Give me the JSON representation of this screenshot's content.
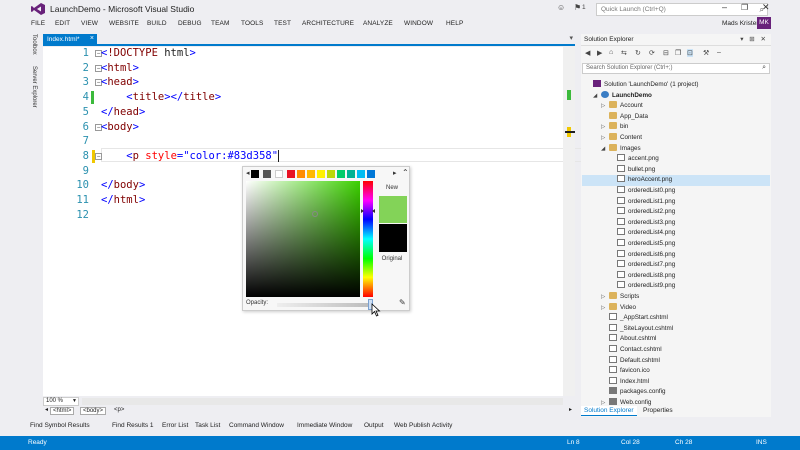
{
  "window": {
    "title": "LaunchDemo - Microsoft Visual Studio",
    "quick_launch_placeholder": "Quick Launch (Ctrl+Q)",
    "notification_count": "1"
  },
  "menu": [
    "FILE",
    "EDIT",
    "VIEW",
    "WEBSITE",
    "BUILD",
    "DEBUG",
    "TEAM",
    "TOOLS",
    "TEST",
    "ARCHITECTURE",
    "ANALYZE",
    "WINDOW",
    "HELP"
  ],
  "user": {
    "name": "Mads Kristensen",
    "initials": "MK"
  },
  "left_rail": [
    "Toolbox",
    "Server Explorer"
  ],
  "document_tab": {
    "label": "Index.html*"
  },
  "editor": {
    "lines": [
      {
        "n": "1",
        "text": "<!DOCTYPE html>"
      },
      {
        "n": "2",
        "text": "<html>"
      },
      {
        "n": "3",
        "text": "<head>"
      },
      {
        "n": "4",
        "text": "    <title></title>"
      },
      {
        "n": "5",
        "text": "</head>"
      },
      {
        "n": "6",
        "text": "<body>"
      },
      {
        "n": "7",
        "text": ""
      },
      {
        "n": "8",
        "text": "    <p style=\"color:#83d358\""
      },
      {
        "n": "9",
        "text": ""
      },
      {
        "n": "10",
        "text": "</body>"
      },
      {
        "n": "11",
        "text": "</html>"
      },
      {
        "n": "12",
        "text": ""
      }
    ],
    "zoom": "100 %",
    "breadcrumbs": [
      "<html>",
      "<body>",
      "<p>"
    ]
  },
  "color_picker": {
    "new_label": "New",
    "original_label": "Original",
    "opacity_label": "Opacity:",
    "new_color": "#83d358",
    "original_color": "#000000",
    "opacity": 1.0,
    "swatches": [
      "#000000",
      "#555555",
      "#ffffff",
      "#e81123",
      "#ff8c00",
      "#ffb900",
      "#fff100",
      "#bad80a",
      "#00cc6a",
      "#00b294",
      "#00bcf2",
      "#0078d7"
    ]
  },
  "solution_explorer": {
    "title": "Solution Explorer",
    "search_placeholder": "Search Solution Explorer (Ctrl+;)",
    "tree": [
      {
        "label": "Solution 'LaunchDemo' (1 project)",
        "icon": "solution-icon",
        "depth": 0,
        "arrow": ""
      },
      {
        "label": "LaunchDemo",
        "icon": "website-globe-icon",
        "depth": 1,
        "arrow": "◢",
        "bold": true
      },
      {
        "label": "Account",
        "icon": "folder-icon",
        "depth": 2,
        "arrow": "▷"
      },
      {
        "label": "App_Data",
        "icon": "folder-icon",
        "depth": 2,
        "arrow": ""
      },
      {
        "label": "bin",
        "icon": "folder-icon",
        "depth": 2,
        "arrow": "▷"
      },
      {
        "label": "Content",
        "icon": "folder-icon",
        "depth": 2,
        "arrow": "▷"
      },
      {
        "label": "Images",
        "icon": "folder-icon",
        "depth": 2,
        "arrow": "◢"
      },
      {
        "label": "accent.png",
        "icon": "image-file-icon",
        "depth": 3,
        "arrow": ""
      },
      {
        "label": "bullet.png",
        "icon": "image-file-icon",
        "depth": 3,
        "arrow": ""
      },
      {
        "label": "heroAccent.png",
        "icon": "image-file-icon",
        "depth": 3,
        "arrow": "",
        "selected": true
      },
      {
        "label": "orderedList0.png",
        "icon": "image-file-icon",
        "depth": 3,
        "arrow": ""
      },
      {
        "label": "orderedList1.png",
        "icon": "image-file-icon",
        "depth": 3,
        "arrow": ""
      },
      {
        "label": "orderedList2.png",
        "icon": "image-file-icon",
        "depth": 3,
        "arrow": ""
      },
      {
        "label": "orderedList3.png",
        "icon": "image-file-icon",
        "depth": 3,
        "arrow": ""
      },
      {
        "label": "orderedList4.png",
        "icon": "image-file-icon",
        "depth": 3,
        "arrow": ""
      },
      {
        "label": "orderedList5.png",
        "icon": "image-file-icon",
        "depth": 3,
        "arrow": ""
      },
      {
        "label": "orderedList6.png",
        "icon": "image-file-icon",
        "depth": 3,
        "arrow": ""
      },
      {
        "label": "orderedList7.png",
        "icon": "image-file-icon",
        "depth": 3,
        "arrow": ""
      },
      {
        "label": "orderedList8.png",
        "icon": "image-file-icon",
        "depth": 3,
        "arrow": ""
      },
      {
        "label": "orderedList9.png",
        "icon": "image-file-icon",
        "depth": 3,
        "arrow": ""
      },
      {
        "label": "Scripts",
        "icon": "folder-icon",
        "depth": 2,
        "arrow": "▷"
      },
      {
        "label": "Video",
        "icon": "folder-icon",
        "depth": 2,
        "arrow": "▷"
      },
      {
        "label": "_AppStart.cshtml",
        "icon": "file-icon",
        "depth": 2,
        "arrow": ""
      },
      {
        "label": "_SiteLayout.cshtml",
        "icon": "file-icon",
        "depth": 2,
        "arrow": ""
      },
      {
        "label": "About.cshtml",
        "icon": "file-icon",
        "depth": 2,
        "arrow": ""
      },
      {
        "label": "Contact.cshtml",
        "icon": "file-icon",
        "depth": 2,
        "arrow": ""
      },
      {
        "label": "Default.cshtml",
        "icon": "file-icon",
        "depth": 2,
        "arrow": ""
      },
      {
        "label": "favicon.ico",
        "icon": "image-file-icon",
        "depth": 2,
        "arrow": ""
      },
      {
        "label": "Index.html",
        "icon": "file-icon",
        "depth": 2,
        "arrow": ""
      },
      {
        "label": "packages.config",
        "icon": "config-file-icon",
        "depth": 2,
        "arrow": ""
      },
      {
        "label": "Web.config",
        "icon": "config-file-icon",
        "depth": 2,
        "arrow": "▷"
      }
    ],
    "tabs": [
      "Solution Explorer",
      "Properties"
    ]
  },
  "tool_tabs": [
    "Find Symbol Results",
    "Find Results 1",
    "Error List",
    "Task List",
    "Command Window",
    "Immediate Window",
    "Output",
    "Web Publish Activity"
  ],
  "status": {
    "state": "Ready",
    "ln": "Ln 8",
    "col": "Col 28",
    "ch": "Ch 28",
    "mode": "INS"
  },
  "colors": {
    "accent": "#007acc",
    "brand": "#68217a",
    "selection": "#cce4f7"
  }
}
